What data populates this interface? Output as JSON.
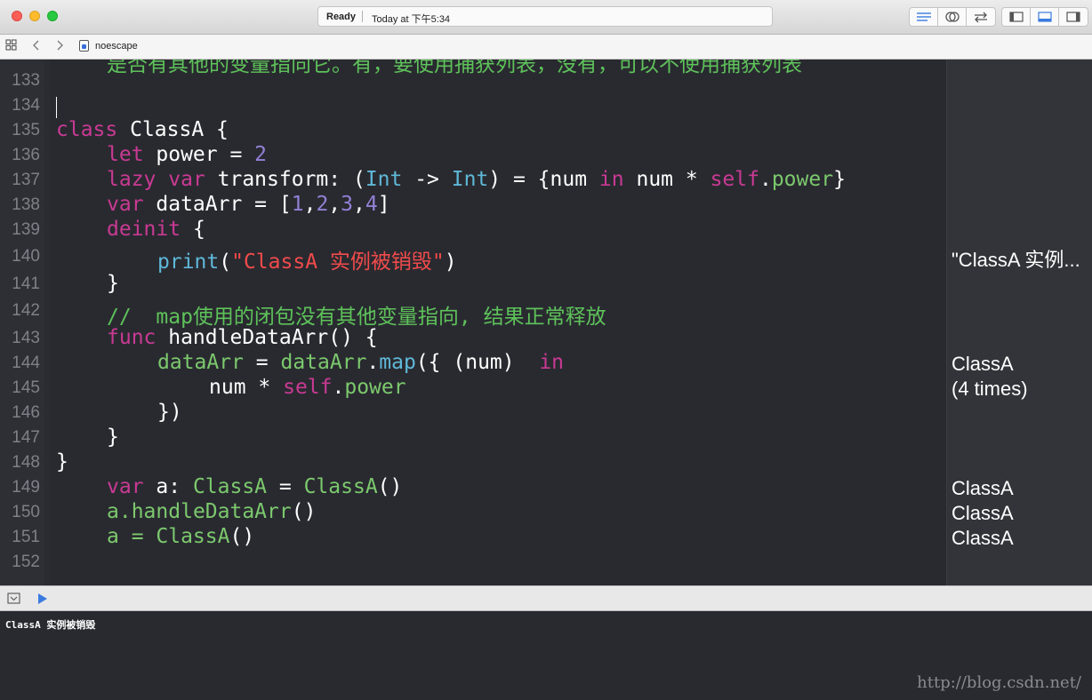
{
  "window": {
    "status_ready": "Ready",
    "status_time": "Today at 下午5:34"
  },
  "jumpbar": {
    "file": "noescape"
  },
  "editor": {
    "top_partial": "是否有其他的变量指向它。有，要使用捕获列表，没有，可以不使用捕获列表",
    "lines": [
      {
        "n": "133"
      },
      {
        "n": "134"
      },
      {
        "n": "135"
      },
      {
        "n": "136"
      },
      {
        "n": "137"
      },
      {
        "n": "138"
      },
      {
        "n": "139"
      },
      {
        "n": "140"
      },
      {
        "n": "141"
      },
      {
        "n": "142"
      },
      {
        "n": "143"
      },
      {
        "n": "144"
      },
      {
        "n": "145"
      },
      {
        "n": "146"
      },
      {
        "n": "147"
      },
      {
        "n": "148"
      },
      {
        "n": "149"
      },
      {
        "n": "150"
      },
      {
        "n": "151"
      },
      {
        "n": "152"
      }
    ],
    "code": {
      "l135": {
        "kw": "class",
        "rest": " ClassA {"
      },
      "l136": {
        "kw": "let",
        "rest": " power = ",
        "num": "2"
      },
      "l137": {
        "kw1": "lazy",
        "kw2": "var",
        "a": " transform: (",
        "t1": "Int",
        "b": " -> ",
        "t2": "Int",
        "c": ") = {num ",
        "kw3": "in",
        "d": " num * ",
        "kw4": "self",
        "e": ".",
        "p": "power",
        "f": "}"
      },
      "l138": {
        "kw": "var",
        "a": " dataArr = [",
        "n1": "1",
        "n2": "2",
        "n3": "3",
        "n4": "4",
        "b": "]"
      },
      "l139": {
        "kw": "deinit",
        "rest": " {"
      },
      "l140": {
        "fn": "print",
        "a": "(",
        "s": "\"ClassA 实例被销毁\"",
        "b": ")"
      },
      "l141": {
        "rest": "}"
      },
      "l142": {
        "cm": "//  map使用的闭包没有其他变量指向, 结果正常释放"
      },
      "l143": {
        "kw": "func",
        "rest": " handleDataArr() {"
      },
      "l144": {
        "p1": "dataArr",
        "a": " = ",
        "p2": "dataArr",
        "b": ".",
        "m": "map",
        "c": "({ (num)  ",
        "kw": "in"
      },
      "l145": {
        "a": "num * ",
        "kw": "self",
        "b": ".",
        "p": "power"
      },
      "l146": {
        "rest": "})"
      },
      "l147": {
        "rest": "}"
      },
      "l148": {
        "rest": "}"
      },
      "l149": {
        "kw": "var",
        "a": " a: ",
        "t1": "ClassA",
        "b": " = ",
        "t2": "ClassA",
        "c": "()"
      },
      "l150": {
        "a": "a.",
        "fn": "handleDataArr",
        "b": "()"
      },
      "l151": {
        "a": "a = ",
        "t": "ClassA",
        "b": "()"
      }
    },
    "results": {
      "r140": "\"ClassA 实例...",
      "r144": "ClassA",
      "r145": "(4 times)",
      "r149": "ClassA",
      "r150": "ClassA",
      "r151": "ClassA"
    }
  },
  "console": {
    "output": "ClassA 实例被销毁",
    "watermark": "http://blog.csdn.net/"
  }
}
